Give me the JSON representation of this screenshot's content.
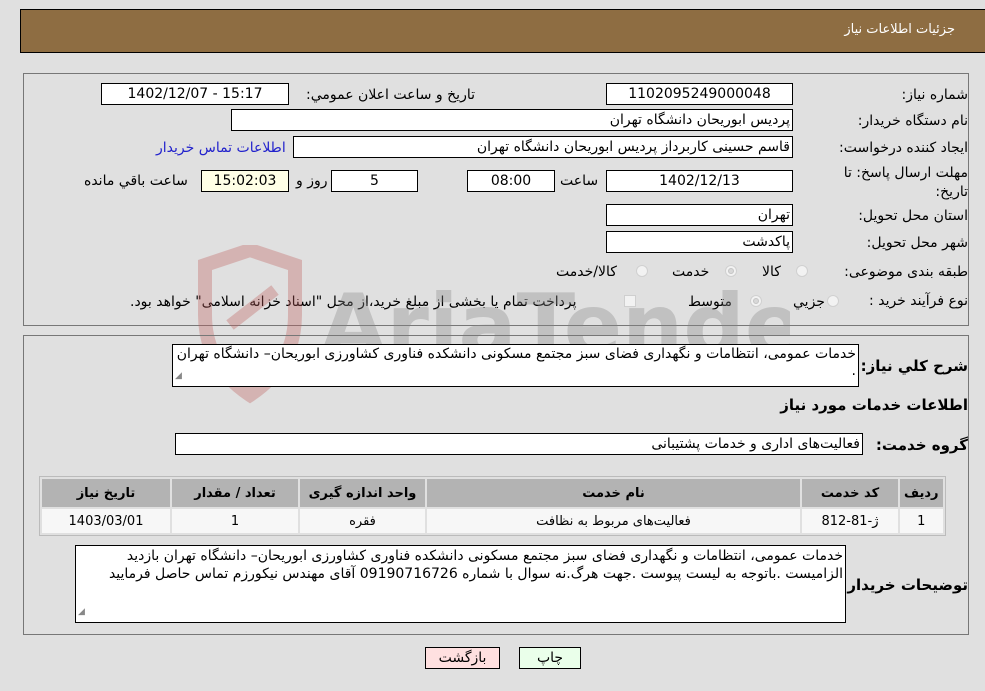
{
  "header": {
    "title": "جزئیات اطلاعات نیاز"
  },
  "form": {
    "need_number": {
      "label": "شماره نیاز:",
      "value": "1102095249000048"
    },
    "announce_datetime": {
      "label": "تاريخ و ساعت اعلان عمومي:",
      "value": "1402/12/07 - 15:17"
    },
    "buyer_org": {
      "label": "نام دستگاه خريدار:",
      "value": "پردیس ابوریحان دانشگاه تهران"
    },
    "requester": {
      "label": "ایجاد کننده درخواست:",
      "value": "قاسم حسینی کاربرداز پردیس ابوریحان دانشگاه تهران"
    },
    "buyer_contact_link": "اطلاعات تماس خريدار",
    "deadline": {
      "label": "مهلت ارسال پاسخ: تا تاريخ:",
      "date": "1402/12/13",
      "time_label": "ساعت",
      "time": "08:00",
      "days": "5",
      "days_label": "روز و",
      "remaining": "15:02:03",
      "remaining_label": "ساعت باقي مانده"
    },
    "province": {
      "label": "استان محل تحویل:",
      "value": "تهران"
    },
    "city": {
      "label": "شهر محل تحویل:",
      "value": "پاکدشت"
    },
    "category": {
      "label": "طبقه بندی موضوعی:",
      "options": [
        "کالا",
        "خدمت",
        "کالا/خدمت"
      ],
      "selected": "خدمت"
    },
    "purchase_type": {
      "label": "نوع فرآيند خريد :",
      "options": [
        "جزيي",
        "متوسط"
      ],
      "selected": "متوسط",
      "treasury_checkbox_label": "پرداخت تمام یا بخشی از مبلغ خرید،از محل \"اسناد خزانه اسلامی\" خواهد بود.",
      "treasury_checked": false
    }
  },
  "details": {
    "description_label": "شرح کلي نياز:",
    "description": "خدمات عمومی، انتظامات و نگهداری فضای سبز مجتمع مسکونی دانشکده فناوری کشاورزی ابوریحان– دانشگاه تهران .",
    "services_heading": "اطلاعات خدمات مورد نياز",
    "service_group_label": "گروه خدمت:",
    "service_group": "فعالیت‌های اداری و خدمات پشتیبانی",
    "table": {
      "headers": [
        "رديف",
        "کد خدمت",
        "نام خدمت",
        "واحد اندازه گيری",
        "تعداد / مقدار",
        "تاريخ نياز"
      ],
      "rows": [
        [
          "1",
          "ژ-81-812",
          "فعالیت‌های مربوط به نظافت",
          "فقره",
          "1",
          "1403/03/01"
        ]
      ]
    },
    "buyer_notes_label": "توضیحات خریدار:",
    "buyer_notes": "خدمات عمومی، انتظامات و نگهداری فضای سبز مجتمع مسکونی دانشکده فناوری کشاورزی ابوریحان– دانشگاه تهران بازدید الزامیست .باتوجه به لیست پیوست .جهت هرگ.نه سوال با شماره 09190716726 آقای مهندس نیکورزم تماس حاصل فرمایید"
  },
  "buttons": {
    "print": "چاپ",
    "back": "بازگشت"
  },
  "watermark": "AriaTender.neT",
  "colors": {
    "header": "#8e6d42",
    "back_button": "#ffe0e0",
    "print_button": "#eaffea",
    "link": "#2222cc",
    "remaining_bg": "#ffffe6"
  }
}
